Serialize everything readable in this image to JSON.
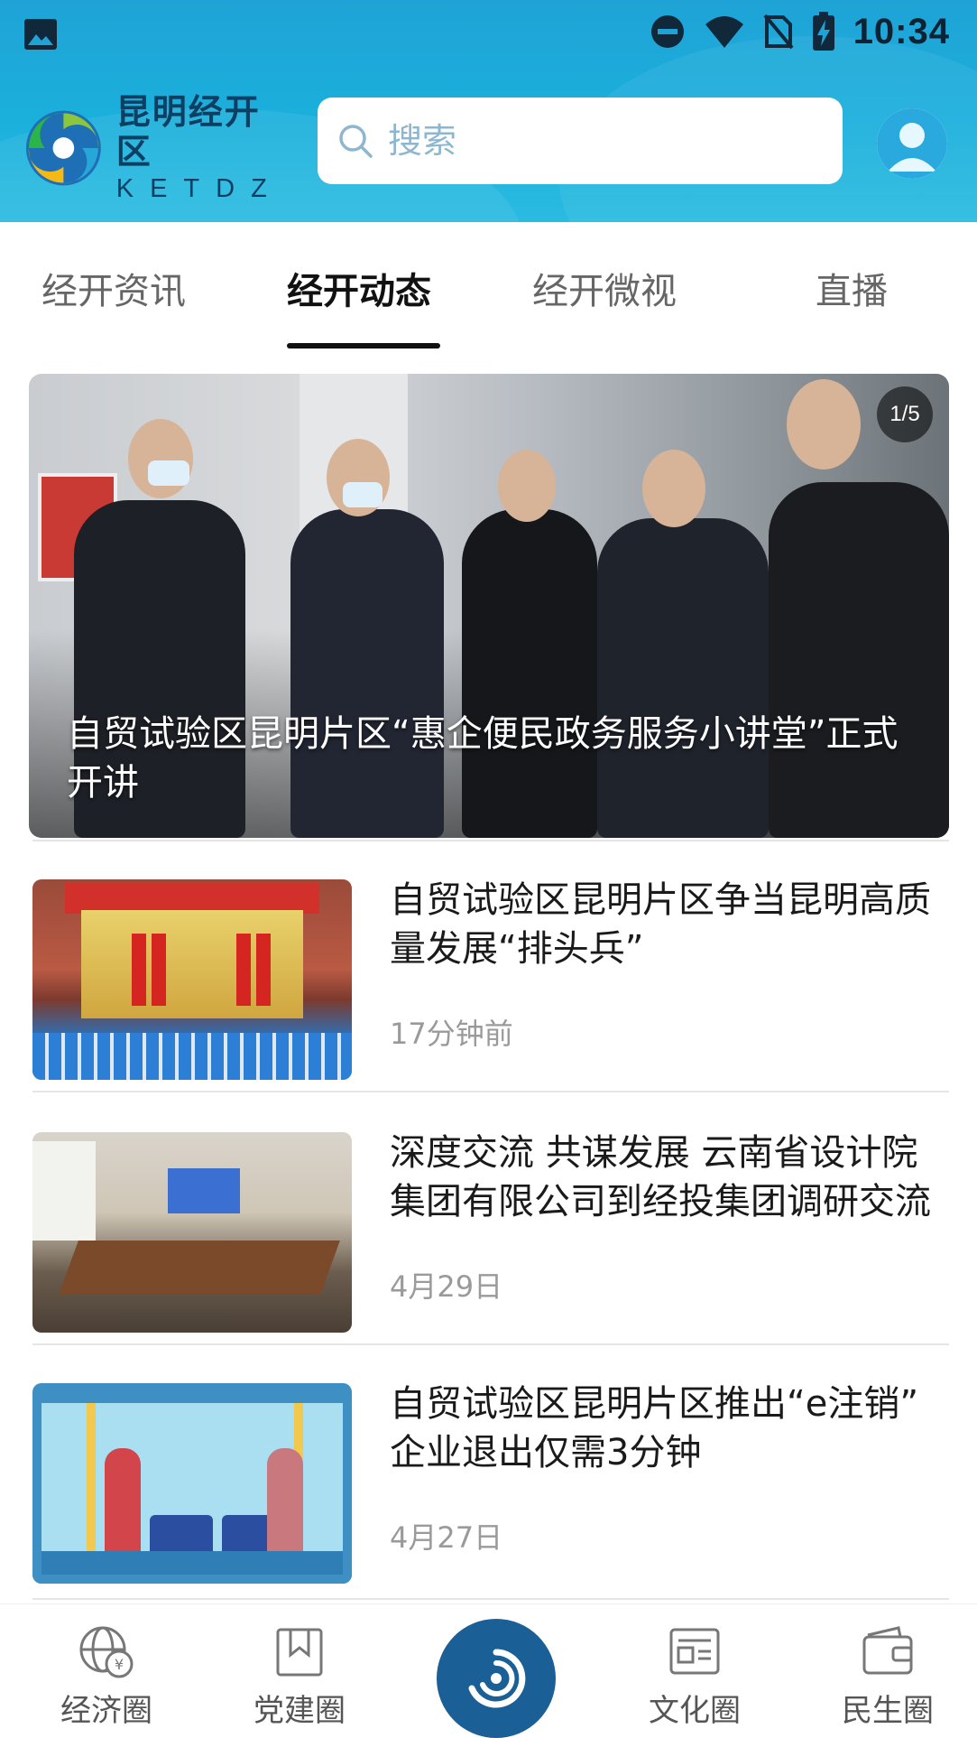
{
  "status_bar": {
    "time": "10:34",
    "icons": [
      "gallery-icon",
      "dnd-icon",
      "wifi-icon",
      "no-sim-icon",
      "battery-charging-icon"
    ]
  },
  "header": {
    "logo_cn": "昆明经开区",
    "logo_en": "KETDZ",
    "search_placeholder": "搜索"
  },
  "tabs": [
    {
      "label": "经开资讯",
      "active": false
    },
    {
      "label": "经开动态",
      "active": true
    },
    {
      "label": "经开微视",
      "active": false
    },
    {
      "label": "直播",
      "active": false
    }
  ],
  "banner": {
    "counter": "1/5",
    "title": "自贸试验区昆明片区“惠企便民政务服务小讲堂”正式开讲"
  },
  "news": [
    {
      "title": "自贸试验区昆明片区争当昆明高质量发展“排头兵”",
      "time": "17分钟前"
    },
    {
      "title": "深度交流 共谋发展 云南省设计院集团有限公司到经投集团调研交流",
      "time": "4月29日"
    },
    {
      "title": "自贸试验区昆明片区推出“e注销” 企业退出仅需3分钟",
      "time": "4月27日"
    }
  ],
  "bottom_nav": [
    {
      "label": "经济圈",
      "icon": "globe-yuan-icon"
    },
    {
      "label": "党建圈",
      "icon": "bookmark-icon"
    },
    {
      "label": "",
      "icon": "logo-swirl-icon"
    },
    {
      "label": "文化圈",
      "icon": "culture-card-icon"
    },
    {
      "label": "民生圈",
      "icon": "wallet-icon"
    }
  ],
  "colors": {
    "header_gradient_top": "#1fa3d6",
    "header_gradient_bottom": "#2bbbe1",
    "logo_text": "#0d3f63",
    "nav_center": "#1a5f95",
    "active_tab": "#111111",
    "muted_text": "#9a9a9a"
  }
}
